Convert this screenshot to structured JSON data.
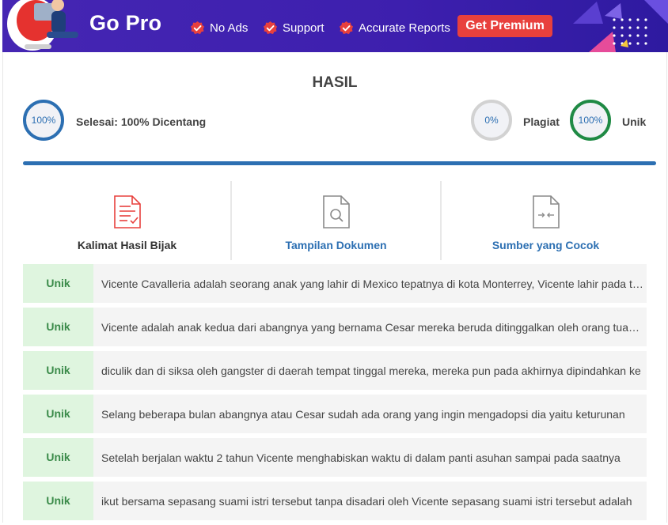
{
  "banner": {
    "title": "Go Pro",
    "features": [
      "No Ads",
      "Support",
      "Accurate Reports"
    ],
    "cta_label": "Get Premium",
    "colors": {
      "background": "#4526b3",
      "cta": "#e8403d",
      "badge": "#e8403d"
    }
  },
  "result": {
    "heading": "HASIL",
    "done": {
      "percent_text": "100%",
      "label": "Selesai: 100% Dicentang",
      "ring_color": "#2c6fb2"
    },
    "plagiat": {
      "percent_text": "0%",
      "label": "Plagiat",
      "ring_color": "#d2d2d2"
    },
    "unik": {
      "percent_text": "100%",
      "label": "Unik",
      "ring_color": "#1f8a44"
    },
    "progress": 1.0
  },
  "tabs": [
    {
      "label": "Kalimat Hasil Bijak",
      "icon": "document-check-icon",
      "color": "#333333"
    },
    {
      "label": "Tampilan Dokumen",
      "icon": "document-search-icon",
      "color": "#2c6fb2"
    },
    {
      "label": "Sumber yang Cocok",
      "icon": "document-compare-icon",
      "color": "#2c6fb2"
    }
  ],
  "rows": [
    {
      "status": "Unik",
      "text": "Vicente Cavalleria adalah seorang anak yang lahir di Mexico tepatnya di kota Monterrey, Vicente lahir pada tahun"
    },
    {
      "status": "Unik",
      "text": "Vicente adalah anak kedua dari abangnya yang bernama Cesar mereka beruda ditinggalkan oleh orang tuanya"
    },
    {
      "status": "Unik",
      "text": "diculik dan di siksa oleh gangster di daerah tempat tinggal mereka, mereka pun pada akhirnya dipindahkan ke"
    },
    {
      "status": "Unik",
      "text": "Selang beberapa bulan abangnya atau Cesar sudah ada orang yang ingin mengadopsi dia yaitu keturunan"
    },
    {
      "status": "Unik",
      "text": "Setelah berjalan waktu 2 tahun Vicente menghabiskan waktu di dalam panti asuhan sampai pada saatnya"
    },
    {
      "status": "Unik",
      "text": "ikut bersama sepasang suami istri tersebut tanpa disadari oleh Vicente sepasang suami istri tersebut adalah"
    }
  ]
}
